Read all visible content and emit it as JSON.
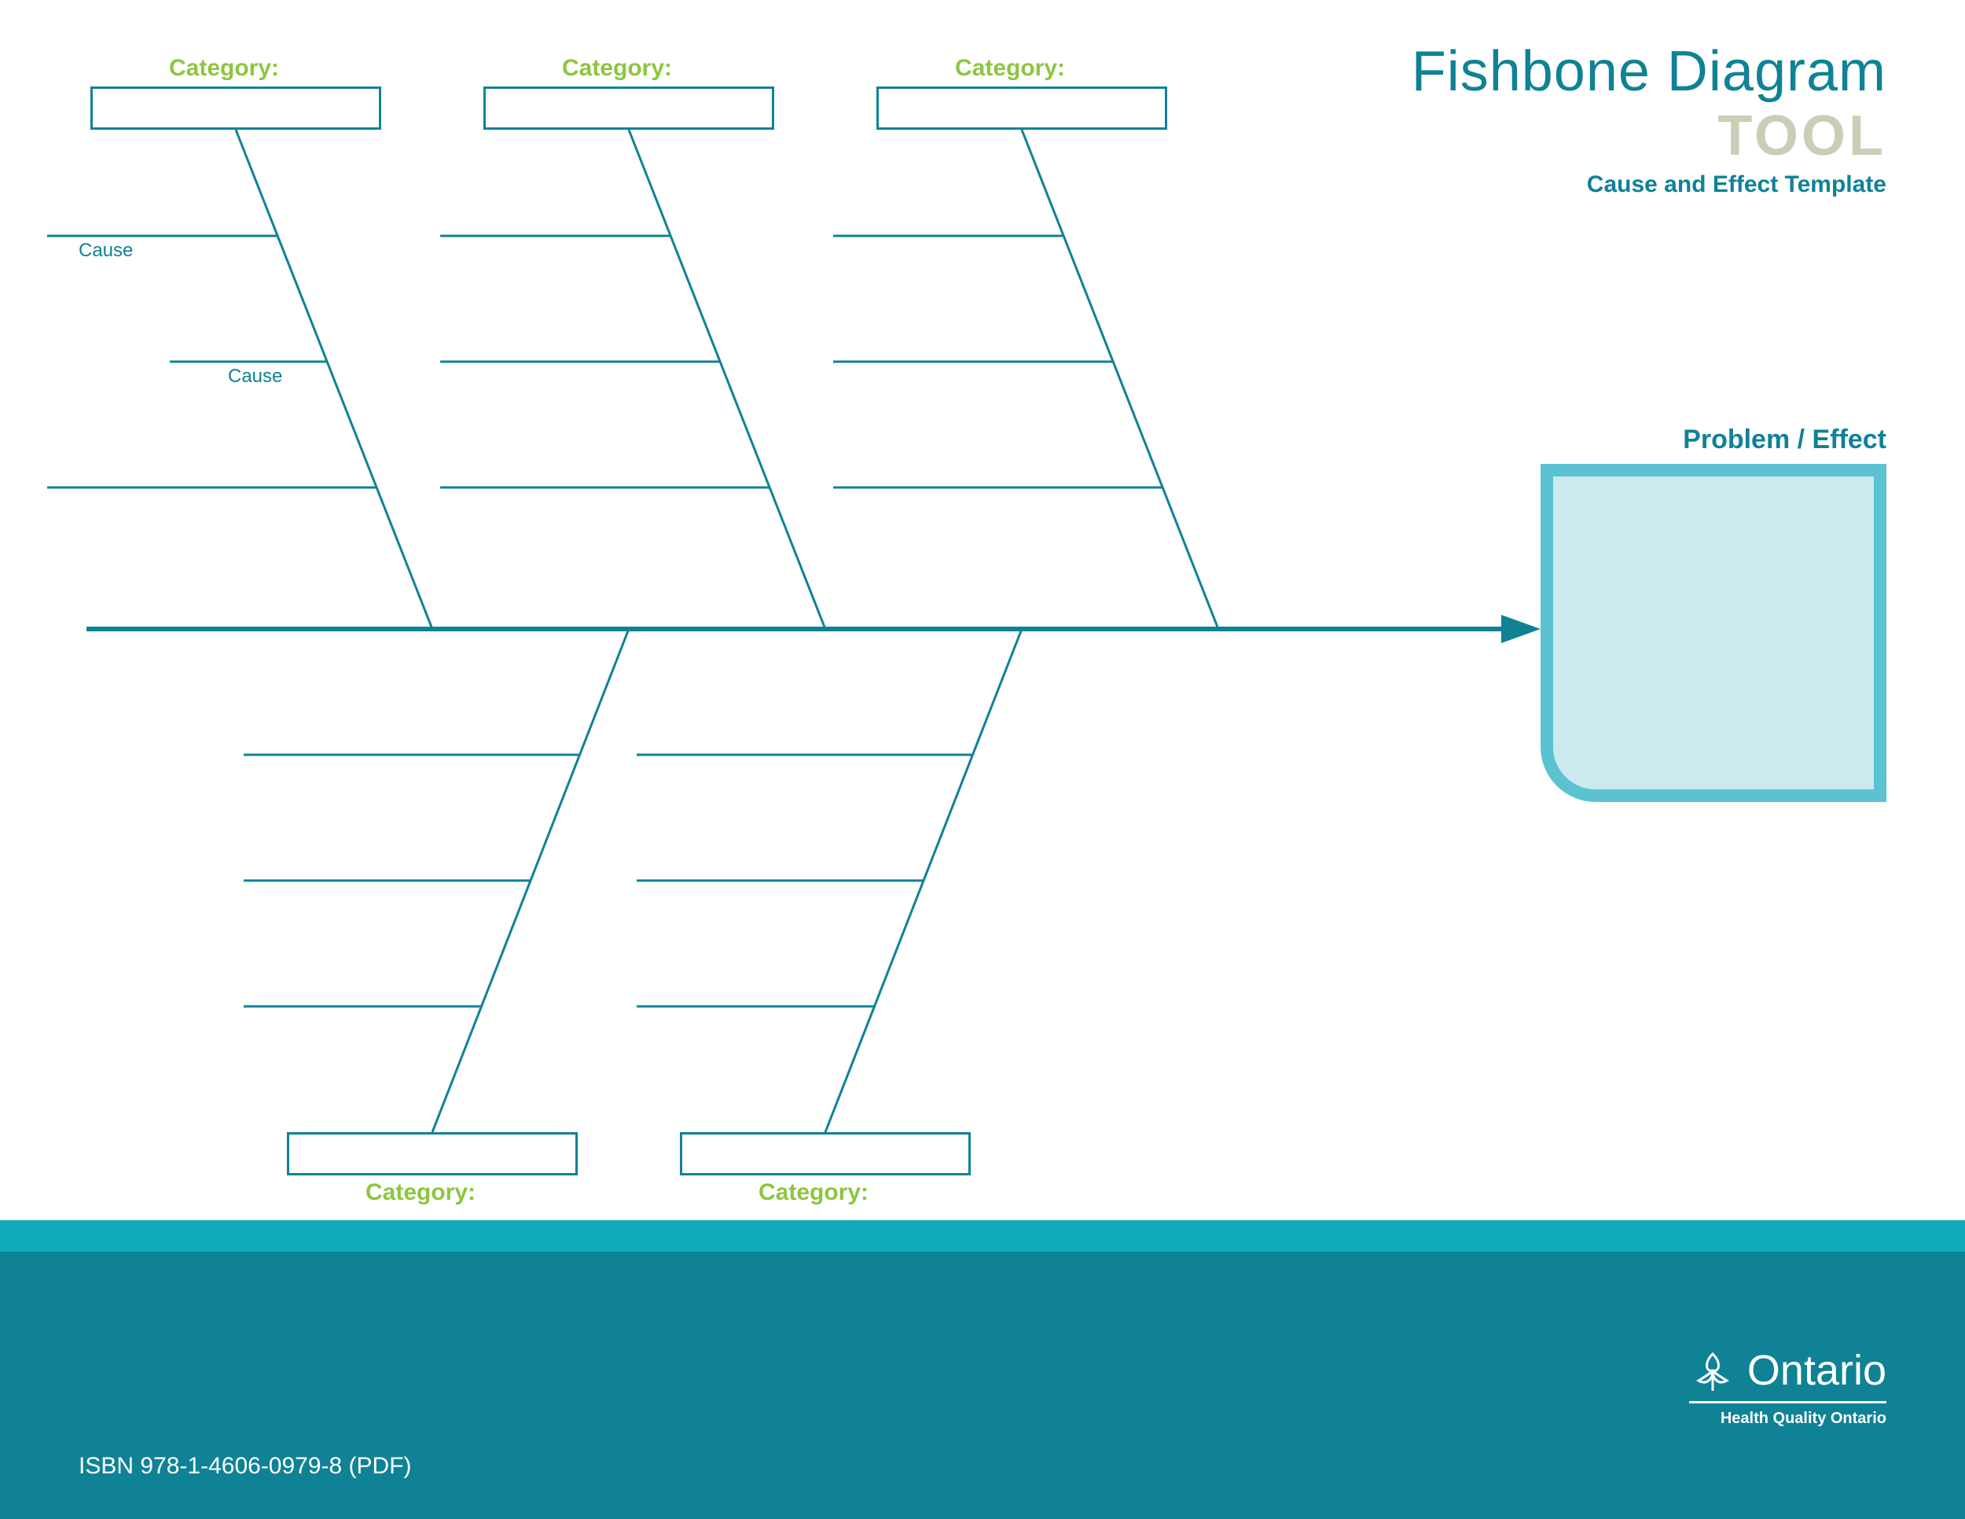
{
  "header": {
    "title_main": "Fishbone Diagram",
    "title_tool": "TOOL",
    "subtitle": "Cause and Effect Template"
  },
  "problem_label": "Problem / Effect",
  "categories": {
    "top": [
      "Category:",
      "Category:",
      "Category:"
    ],
    "bottom": [
      "Category:",
      "Category:"
    ]
  },
  "cause_labels": {
    "cause1": "Cause",
    "cause2": "Cause"
  },
  "footer": {
    "isbn": "ISBN 978-1-4606-0979-8 (PDF)",
    "logo_text": "Ontario",
    "logo_sub": "Health Quality Ontario"
  }
}
